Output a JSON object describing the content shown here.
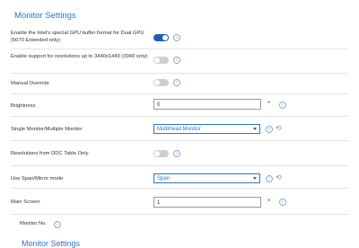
{
  "header": {
    "title": "Monitor Settings"
  },
  "rows": [
    {
      "label": "Enable the Intel's special GPU buffer format for Dual GPU (5070 Extended only)",
      "state": "on"
    },
    {
      "label": "Enable support for resolutions up to 3440x1440 (3040 only)",
      "state": "off"
    },
    {
      "label": "Manual Override",
      "state": "off"
    },
    {
      "label": "Brightness",
      "value": "0"
    },
    {
      "label": "Single Monitor/Multiple Monitor",
      "value": "MultiHead Monitor"
    },
    {
      "label": "Resolutions from DDC Table Only",
      "state": "off"
    },
    {
      "label": "Use Span/Mirror mode",
      "value": "Span"
    },
    {
      "label": "Main Screen",
      "value": "1"
    }
  ],
  "monitor_no": {
    "label": "Monitor No."
  },
  "next_section": {
    "title": "Monitor Settings"
  },
  "glyphs": {
    "info": "i",
    "required": "*",
    "reset": "⟲"
  },
  "colors": {
    "accent": "#2f75c7",
    "toggle_on": "#1e5fb5",
    "required": "#e53935"
  }
}
